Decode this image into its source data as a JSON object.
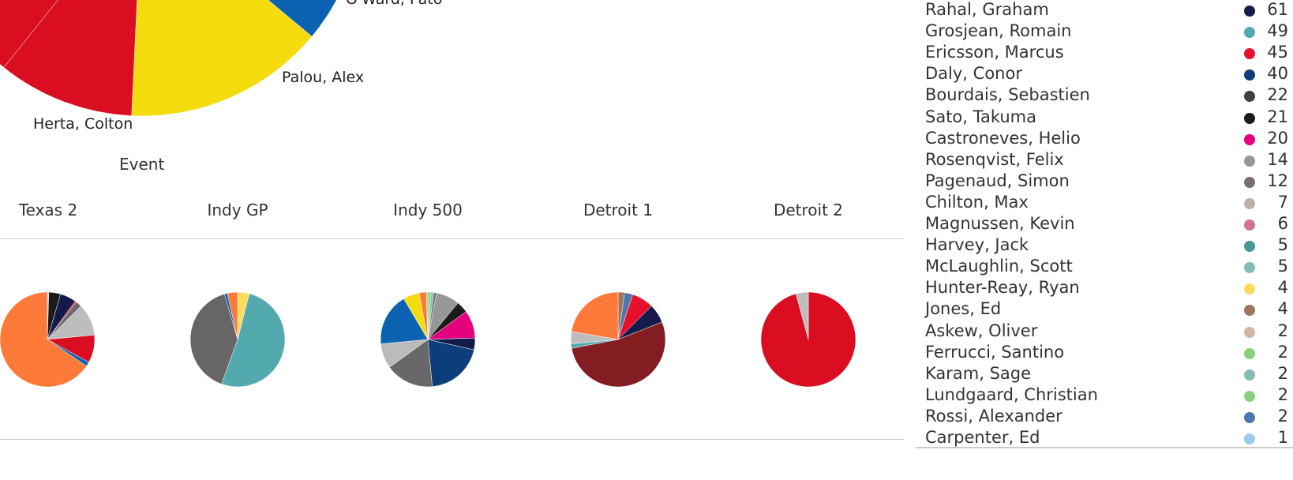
{
  "chart_data": [
    {
      "type": "pie",
      "slice_labels": [
        "Herta, Colton",
        "Palou, Alex",
        "O'Ward, Pato"
      ],
      "slices": [
        {
          "color": "#DA0E20",
          "share": 10
        },
        {
          "color": "#F5DC0F",
          "share": 14.7,
          "label": "Herta, Colton"
        },
        {
          "color": "#0C62B1",
          "share": 8
        },
        {
          "color": "#B9B9B9",
          "share": 5
        }
      ],
      "label_palou": "Palou, Alex",
      "label_oward": "O'Ward, Pato",
      "label_herta": "Herta, Colton",
      "column_header": "Event"
    },
    {
      "type": "pie",
      "event": "Texas 2",
      "slices": [
        {
          "color": "#9ECBEA",
          "share": 0.5
        },
        {
          "color": "#1B1B1B",
          "share": 4
        },
        {
          "color": "#141A4A",
          "share": 5.5
        },
        {
          "color": "#E8112D",
          "share": 0.5
        },
        {
          "color": "#6B6B6B",
          "share": 2
        },
        {
          "color": "#BDBDBD",
          "share": 11
        },
        {
          "color": "#DA0E20",
          "share": 9.5
        },
        {
          "color": "#0C62B1",
          "share": 1.5
        },
        {
          "color": "#FF7A38",
          "share": 65.5
        }
      ]
    },
    {
      "type": "pie",
      "event": "Indy GP",
      "slices": [
        {
          "color": "#FFDC5C",
          "share": 4
        },
        {
          "color": "#52AAAF",
          "share": 51.5
        },
        {
          "color": "#666666",
          "share": 40
        },
        {
          "color": "#0C62B1",
          "share": 1
        },
        {
          "color": "#FF7A38",
          "share": 3.5
        }
      ]
    },
    {
      "type": "pie",
      "event": "Indy 500",
      "slices": [
        {
          "color": "#8AD07A",
          "share": 1
        },
        {
          "color": "#86BCB6",
          "share": 1
        },
        {
          "color": "#7B7070",
          "share": 1
        },
        {
          "color": "#969796",
          "share": 8
        },
        {
          "color": "#1B1B1B",
          "share": 4
        },
        {
          "color": "#E5007E",
          "share": 9.5
        },
        {
          "color": "#141A4A",
          "share": 4
        },
        {
          "color": "#0B3E7A",
          "share": 20
        },
        {
          "color": "#686868",
          "share": 16.5
        },
        {
          "color": "#BBBBBB",
          "share": 8.5
        },
        {
          "color": "#0C62B1",
          "share": 18
        },
        {
          "color": "#F5DC0F",
          "share": 5.5
        },
        {
          "color": "#FF7A38",
          "share": 2.5
        },
        {
          "color": "#8AD07A",
          "share": 0.5
        }
      ]
    },
    {
      "type": "pie",
      "event": "Detroit 1",
      "slices": [
        {
          "color": "#A0735C",
          "share": 2.2
        },
        {
          "color": "#4C79AD",
          "share": 2.8
        },
        {
          "color": "#E8112D",
          "share": 7.5
        },
        {
          "color": "#141A4A",
          "share": 6.5
        },
        {
          "color": "#831D22",
          "share": 53
        },
        {
          "color": "#52AAAF",
          "share": 1.5
        },
        {
          "color": "#BDBDBD",
          "share": 4.2
        },
        {
          "color": "#FF7A38",
          "share": 22.3
        }
      ]
    },
    {
      "type": "pie",
      "event": "Detroit 2",
      "slices": [
        {
          "color": "#DA0E20",
          "share": 95.8
        },
        {
          "color": "#BDBDBD",
          "share": 4.2
        }
      ]
    }
  ],
  "legend": [
    {
      "name": "Rahal, Graham",
      "value": "61",
      "color": "#141A4A"
    },
    {
      "name": "Grosjean, Romain",
      "value": "49",
      "color": "#52AAAF"
    },
    {
      "name": "Ericsson, Marcus",
      "value": "45",
      "color": "#E8112D"
    },
    {
      "name": "Daly, Conor",
      "value": "40",
      "color": "#0B3E7A"
    },
    {
      "name": "Bourdais, Sebastien",
      "value": "22",
      "color": "#404040"
    },
    {
      "name": "Sato, Takuma",
      "value": "21",
      "color": "#1B1B1B"
    },
    {
      "name": "Castroneves, Helio",
      "value": "20",
      "color": "#E5007E"
    },
    {
      "name": "Rosenqvist, Felix",
      "value": "14",
      "color": "#969796"
    },
    {
      "name": "Pagenaud, Simon",
      "value": "12",
      "color": "#7B7070"
    },
    {
      "name": "Chilton, Max",
      "value": "7",
      "color": "#BAB0AC"
    },
    {
      "name": "Magnussen, Kevin",
      "value": "6",
      "color": "#D37295"
    },
    {
      "name": "Harvey, Jack",
      "value": "5",
      "color": "#499894"
    },
    {
      "name": "McLaughlin, Scott",
      "value": "5",
      "color": "#86BCB6"
    },
    {
      "name": "Hunter-Reay, Ryan",
      "value": "4",
      "color": "#FFDC5C"
    },
    {
      "name": "Jones, Ed",
      "value": "4",
      "color": "#9D7660"
    },
    {
      "name": "Askew, Oliver",
      "value": "2",
      "color": "#D4B4A3"
    },
    {
      "name": "Ferrucci, Santino",
      "value": "2",
      "color": "#8AD07A"
    },
    {
      "name": "Karam, Sage",
      "value": "2",
      "color": "#86BCB6"
    },
    {
      "name": "Lundgaard, Christian",
      "value": "2",
      "color": "#8AD07A"
    },
    {
      "name": "Rossi, Alexander",
      "value": "2",
      "color": "#4C79AD"
    },
    {
      "name": "Carpenter, Ed",
      "value": "1",
      "color": "#9ECBEA"
    }
  ]
}
